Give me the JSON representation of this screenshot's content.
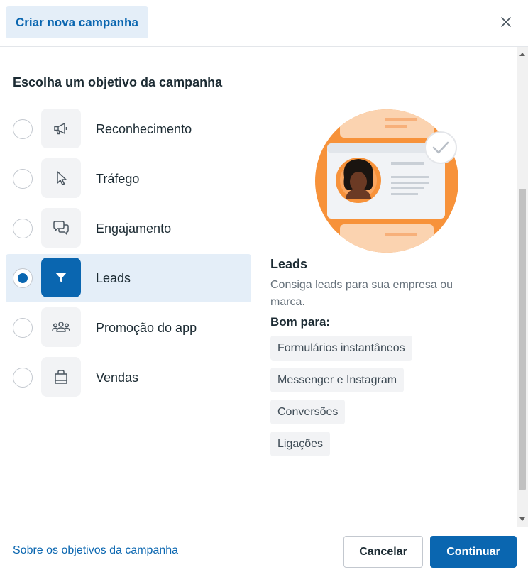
{
  "header": {
    "title": "Criar nova campanha",
    "close_icon": "close-icon"
  },
  "main": {
    "section_title": "Escolha um objetivo da campanha",
    "objectives": [
      {
        "label": "Reconhecimento",
        "icon": "megaphone-icon",
        "selected": false
      },
      {
        "label": "Tráfego",
        "icon": "cursor-icon",
        "selected": false
      },
      {
        "label": "Engajamento",
        "icon": "chat-bubbles-icon",
        "selected": false
      },
      {
        "label": "Leads",
        "icon": "funnel-icon",
        "selected": true
      },
      {
        "label": "Promoção do app",
        "icon": "people-group-icon",
        "selected": false
      },
      {
        "label": "Vendas",
        "icon": "shopping-bag-icon",
        "selected": false
      }
    ],
    "detail": {
      "title": "Leads",
      "description": "Consiga leads para sua empresa ou marca.",
      "good_for_label": "Bom para:",
      "chips": [
        "Formulários instantâneos",
        "Messenger e Instagram",
        "Conversões",
        "Ligações"
      ]
    }
  },
  "footer": {
    "link": "Sobre os objetivos da campanha",
    "cancel_label": "Cancelar",
    "continue_label": "Continuar"
  },
  "colors": {
    "accent": "#0a66b0",
    "selected_bg": "#e4eef8",
    "illustration_orange": "#f7923a"
  }
}
